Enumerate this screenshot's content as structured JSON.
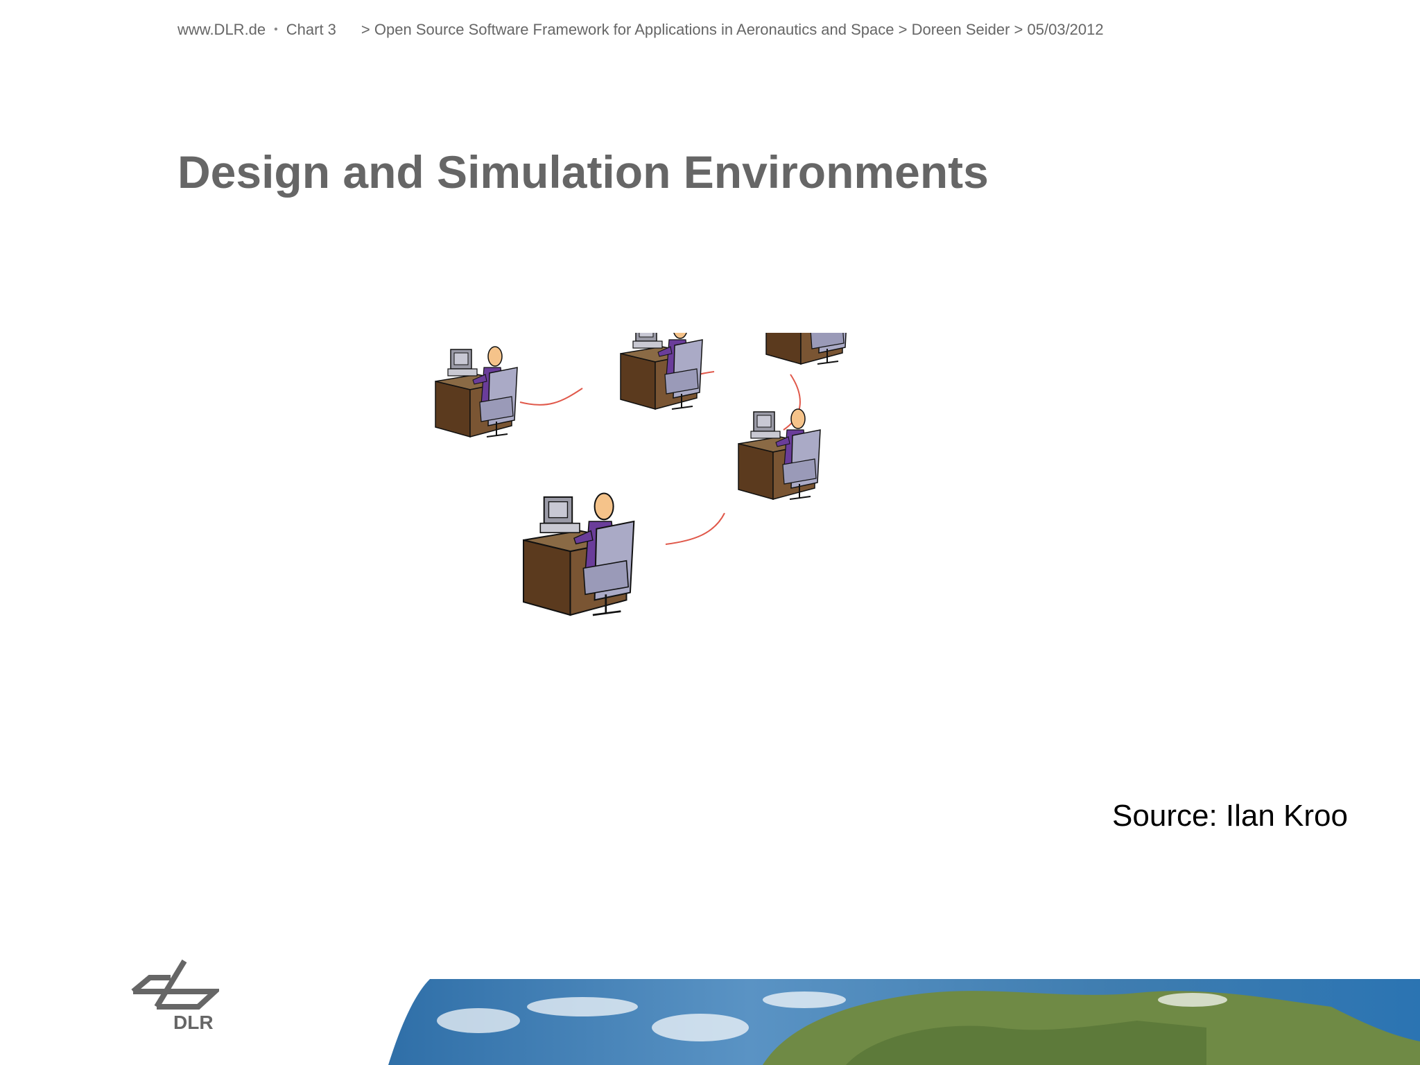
{
  "header": {
    "site": "www.DLR.de",
    "separator": "•",
    "chart": "Chart 3",
    "breadcrumb": "> Open Source Software Framework for Applications in Aeronautics and Space > Doreen Seider > 05/03/2012"
  },
  "title": "Design and Simulation Environments",
  "source": "Source: Ilan Kroo",
  "logo": {
    "text": "DLR",
    "icon": "dlr-logo-icon"
  },
  "colors": {
    "text_gray": "#666666",
    "desk_brown": "#6b4a2b",
    "chair_gray": "#a9a9c8",
    "person_purple": "#6a3d9a",
    "skin": "#f5c38a",
    "link_red": "#e0584a"
  },
  "workstations": [
    {
      "id": "ws1"
    },
    {
      "id": "ws2"
    },
    {
      "id": "ws3"
    },
    {
      "id": "ws4"
    },
    {
      "id": "ws5"
    }
  ]
}
